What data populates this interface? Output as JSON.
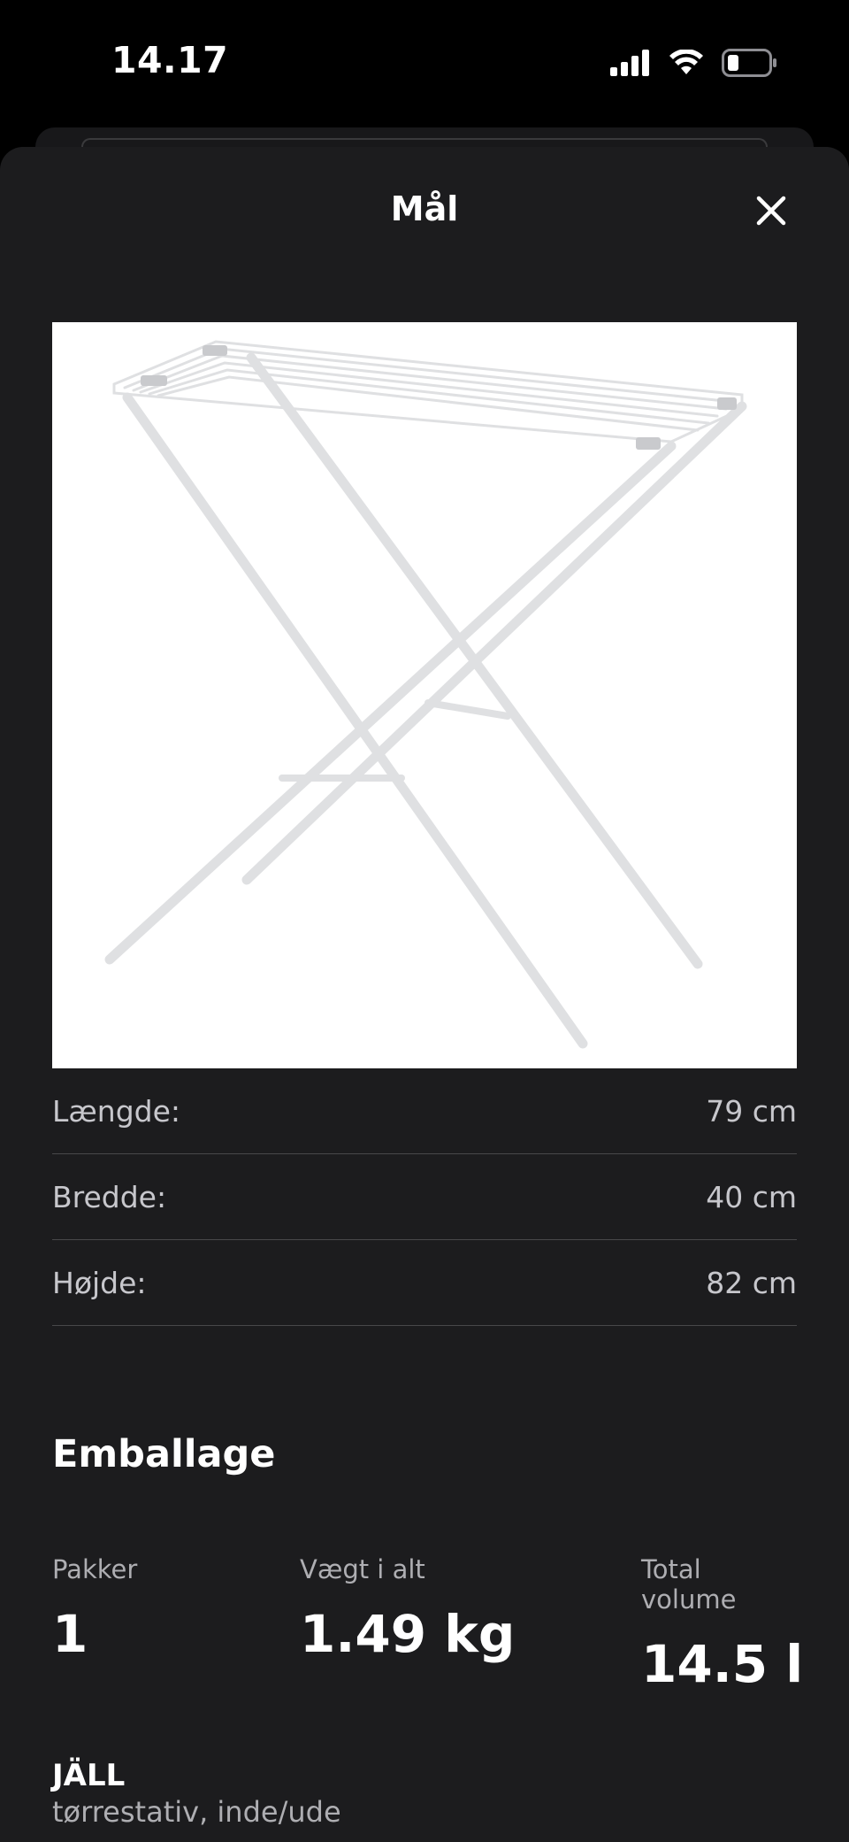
{
  "status_bar": {
    "time": "14.17",
    "icons": [
      "cellular-signal-icon",
      "wifi-icon",
      "battery-icon"
    ]
  },
  "sheet": {
    "title": "Mål",
    "close_icon": "close-icon"
  },
  "dimensions": [
    {
      "label": "Længde:",
      "value": "79 cm"
    },
    {
      "label": "Bredde:",
      "value": "40 cm"
    },
    {
      "label": "Højde:",
      "value": "82 cm"
    }
  ],
  "packaging": {
    "title": "Emballage",
    "items": [
      {
        "label": "Pakker",
        "value": "1"
      },
      {
        "label": "Vægt i alt",
        "value": "1.49 kg"
      },
      {
        "label": "Total volume",
        "value": "14.5 l"
      }
    ]
  },
  "product": {
    "name": "JÄLL",
    "description": "tørrestativ, inde/ude"
  },
  "colors": {
    "sheet_background": "#1c1c1e",
    "divider": "#48484a"
  }
}
